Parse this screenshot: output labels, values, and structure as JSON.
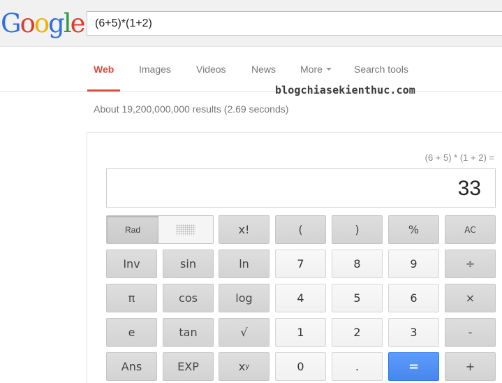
{
  "logo": {
    "letters": [
      {
        "char": "G",
        "color": "#2f6fe0"
      },
      {
        "char": "o",
        "color": "#dd3c2c"
      },
      {
        "char": "o",
        "color": "#f2b100"
      },
      {
        "char": "g",
        "color": "#2f6fe0"
      },
      {
        "char": "l",
        "color": "#2e9a3f"
      },
      {
        "char": "e",
        "color": "#dd3c2c"
      }
    ]
  },
  "search": {
    "query": "(6+5)*(1+2)"
  },
  "nav": {
    "tabs": [
      {
        "label": "Web",
        "active": true
      },
      {
        "label": "Images"
      },
      {
        "label": "Videos"
      },
      {
        "label": "News"
      },
      {
        "label": "More"
      },
      {
        "label": "Search tools"
      }
    ]
  },
  "watermark": "blogchiasekienthuc.com",
  "results": {
    "stats": "About 19,200,000,000 results (2.69 seconds)"
  },
  "calculator": {
    "expression": "(6 + 5) * (1 + 2) =",
    "display": "33",
    "mode": {
      "rad_label": "Rad",
      "selected": "Rad"
    },
    "keys": [
      [
        "x!",
        "(",
        ")",
        "%",
        "AC"
      ],
      [
        "Inv",
        "sin",
        "ln",
        "7",
        "8",
        "9",
        "÷"
      ],
      [
        "π",
        "cos",
        "log",
        "4",
        "5",
        "6",
        "×"
      ],
      [
        "e",
        "tan",
        "√",
        "1",
        "2",
        "3",
        "-"
      ],
      [
        "Ans",
        "EXP",
        "x",
        "0",
        ".",
        "=",
        "+"
      ]
    ],
    "power_superscript": "y"
  },
  "colors": {
    "accent_red": "#dd4b39",
    "equals_blue": "#4d90fe"
  }
}
